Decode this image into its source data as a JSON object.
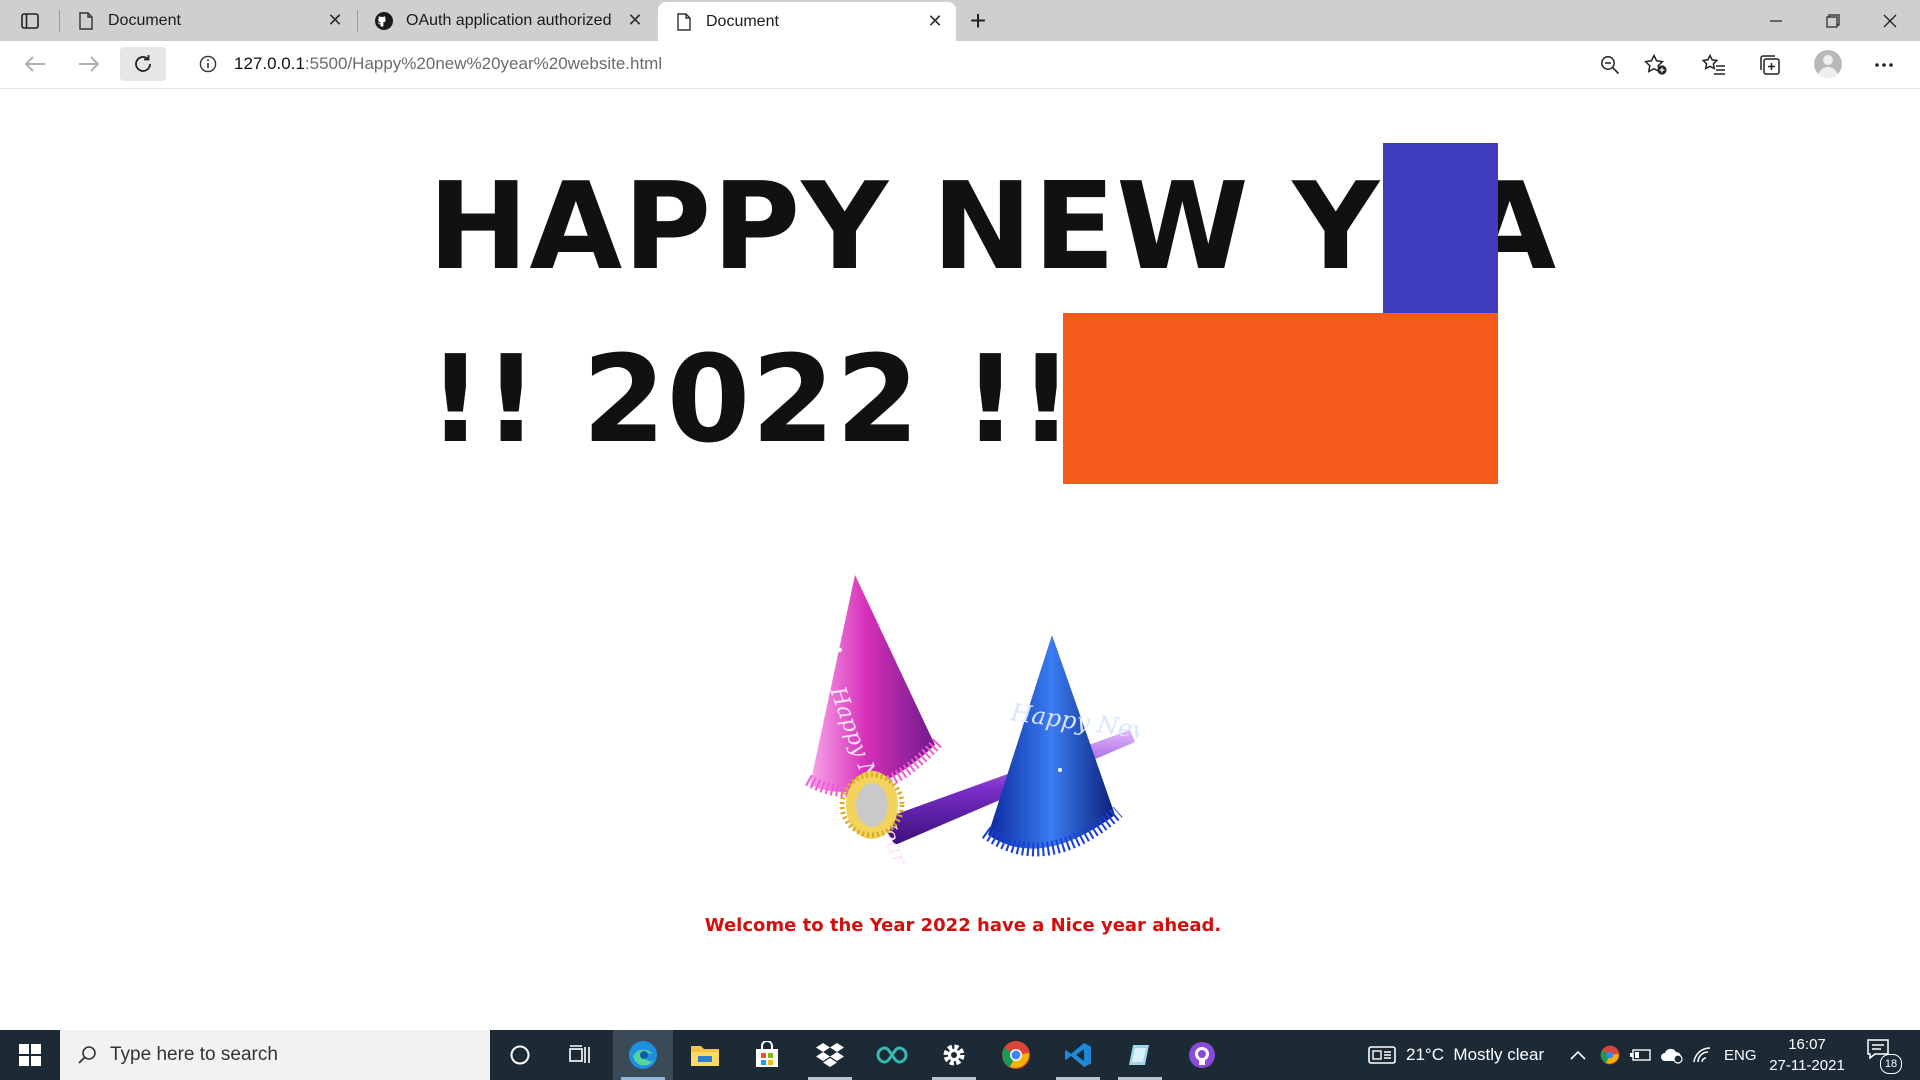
{
  "browser": {
    "tabs": [
      {
        "label": "Document",
        "favicon": "page-icon",
        "active": false
      },
      {
        "label": "OAuth application authorized",
        "favicon": "github-icon",
        "active": false
      },
      {
        "label": "Document",
        "favicon": "page-icon",
        "active": true
      }
    ],
    "address": {
      "host": "127.0.0.1",
      "path": ":5500/Happy%20new%20year%20website.html"
    }
  },
  "page": {
    "heading_line1": "HAPPY NEW YEA",
    "heading_line2": "!! 2022 !!",
    "hat_text_pink": "Happy New Year",
    "hat_text_blue": "Happy New Year",
    "welcome": "Welcome to the Year 2022 have a Nice year ahead.",
    "colors": {
      "heading": "#111111",
      "blue_box": "#3f3cc0",
      "orange_box": "#f55b1a",
      "welcome": "#d40d0d"
    }
  },
  "taskbar": {
    "search_placeholder": "Type here to search",
    "apps": [
      "cortana-icon",
      "task-view-icon",
      "edge-icon",
      "file-explorer-icon",
      "store-icon",
      "dropbox-icon",
      "arduino-icon",
      "settings-icon",
      "chrome-icon",
      "vscode-icon",
      "notes-icon",
      "github-desktop-icon"
    ],
    "weather": "21°C  Mostly clear",
    "language": "ENG",
    "time": "16:07",
    "date": "27-11-2021",
    "notification_count": "18"
  }
}
